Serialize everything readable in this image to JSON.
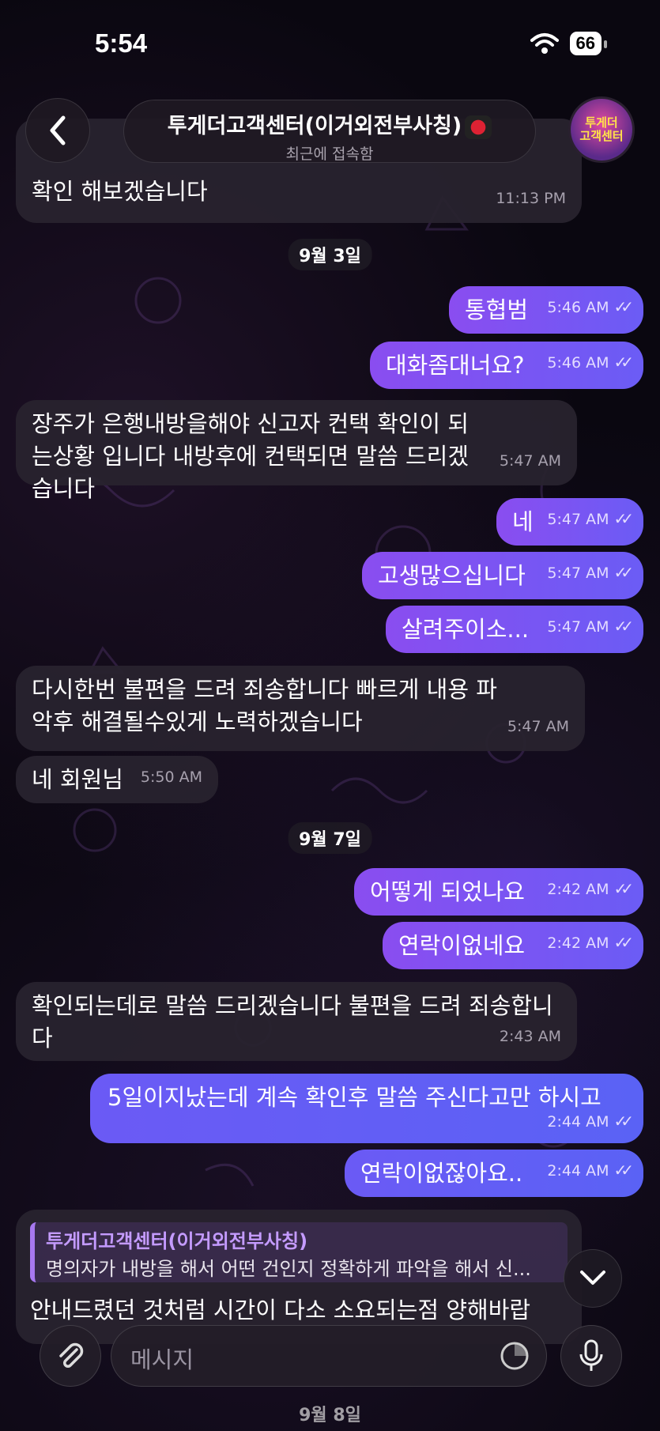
{
  "status": {
    "time": "5:54",
    "battery": "66"
  },
  "header": {
    "title": "투게더고객센터(이거외전부사칭)",
    "subtitle": "최근에 접속함",
    "avatar_text": "투게더\n고객센터"
  },
  "messages": [
    {
      "text": "확인 해보겠습니다",
      "time": "11:13 PM"
    },
    {
      "date": "9월 3일"
    },
    {
      "text": "통협범",
      "time": "5:46 AM"
    },
    {
      "text": "대화좀대너요?",
      "time": "5:46 AM"
    },
    {
      "text": "장주가 은행내방을해야 신고자 컨택 확인이 되는상황 입니다 내방후에 컨택되면 말씀 드리겠습니다",
      "time": "5:47 AM"
    },
    {
      "text": "네",
      "time": "5:47 AM"
    },
    {
      "text": "고생많으십니다",
      "time": "5:47 AM"
    },
    {
      "text": "살려주이소...",
      "time": "5:47 AM"
    },
    {
      "text": "다시한번 불편을 드려 죄송합니다 빠르게 내용 파악후 해결될수있게 노력하겠습니다",
      "time": "5:47 AM"
    },
    {
      "text": "네 회원님",
      "time": "5:50 AM"
    },
    {
      "date": "9월 7일"
    },
    {
      "text": "어떻게 되었나요",
      "time": "2:42 AM"
    },
    {
      "text": "연락이없네요",
      "time": "2:42 AM"
    },
    {
      "text": "확인되는데로 말씀 드리겠습니다 불편을 드려 죄송합니다",
      "time": "2:43 AM"
    },
    {
      "text": "5일이지났는데 계속 확인후 말씀 주신다고만 하시고",
      "time": "2:44 AM"
    },
    {
      "text": "연락이없잖아요..",
      "time": "2:44 AM"
    }
  ],
  "quoted": {
    "name": "투게더고객센터(이거외전부사칭)",
    "text": "명의자가 내방을 해서 어떤 건인지 정확하게 파악을 해서 신...",
    "body": "안내드렸던 것처럼 시간이 다소 소요되는점 양해바랍"
  },
  "input": {
    "placeholder": "메시지"
  },
  "bottom_date": "9월 8일"
}
